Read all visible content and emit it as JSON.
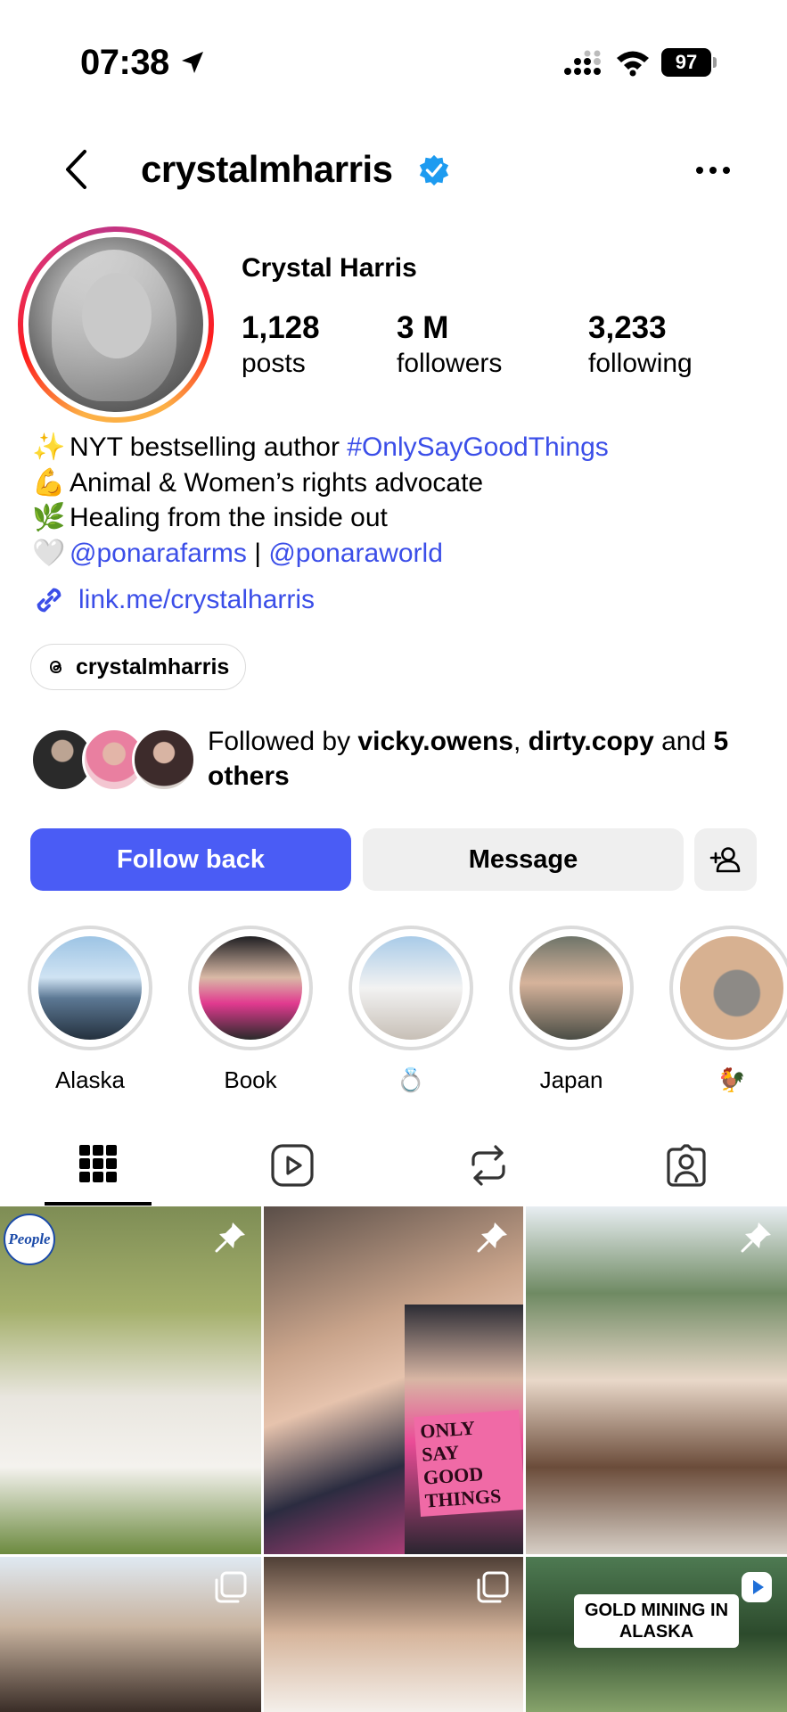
{
  "status_bar": {
    "time": "07:38",
    "battery": "97"
  },
  "header": {
    "username": "crystalmharris"
  },
  "profile": {
    "display_name": "Crystal Harris",
    "stats": [
      {
        "value": "1,128",
        "label": "posts"
      },
      {
        "value": "3 M",
        "label": "followers"
      },
      {
        "value": "3,233",
        "label": "following"
      }
    ],
    "bio": [
      {
        "emoji": "✨",
        "text": "NYT bestselling author ",
        "tag": "#OnlySayGoodThings"
      },
      {
        "emoji": "💪",
        "text": "Animal & Women’s rights advocate"
      },
      {
        "emoji": "🌿",
        "text": "Healing from the inside out"
      },
      {
        "emoji": "🤍",
        "mention1": "@ponarafarms",
        "sep": " | ",
        "mention2": "@ponaraworld"
      }
    ],
    "link": "link.me/crystalharris",
    "threads_handle": "crystalmharris",
    "followed_by": {
      "prefix": "Followed by ",
      "user1": "vicky.owens",
      "sep": ", ",
      "user2": "dirty.copy",
      "and": " and ",
      "others": "5 others"
    }
  },
  "actions": {
    "follow_back": "Follow back",
    "message": "Message"
  },
  "highlights": [
    {
      "label": "Alaska"
    },
    {
      "label": "Book"
    },
    {
      "label": "💍"
    },
    {
      "label": "Japan"
    },
    {
      "label": "🐓"
    }
  ],
  "tabs": [
    "posts-grid",
    "reels",
    "reposts",
    "tagged"
  ],
  "grid": {
    "people_logo": "People",
    "book_title": "ONLY SAY GOOD THINGS",
    "gold_caption": "GOLD MINING IN ALASKA"
  },
  "colors": {
    "accent": "#4a5cf5",
    "link": "#3b4ee8",
    "verified": "#1d9bf0"
  }
}
